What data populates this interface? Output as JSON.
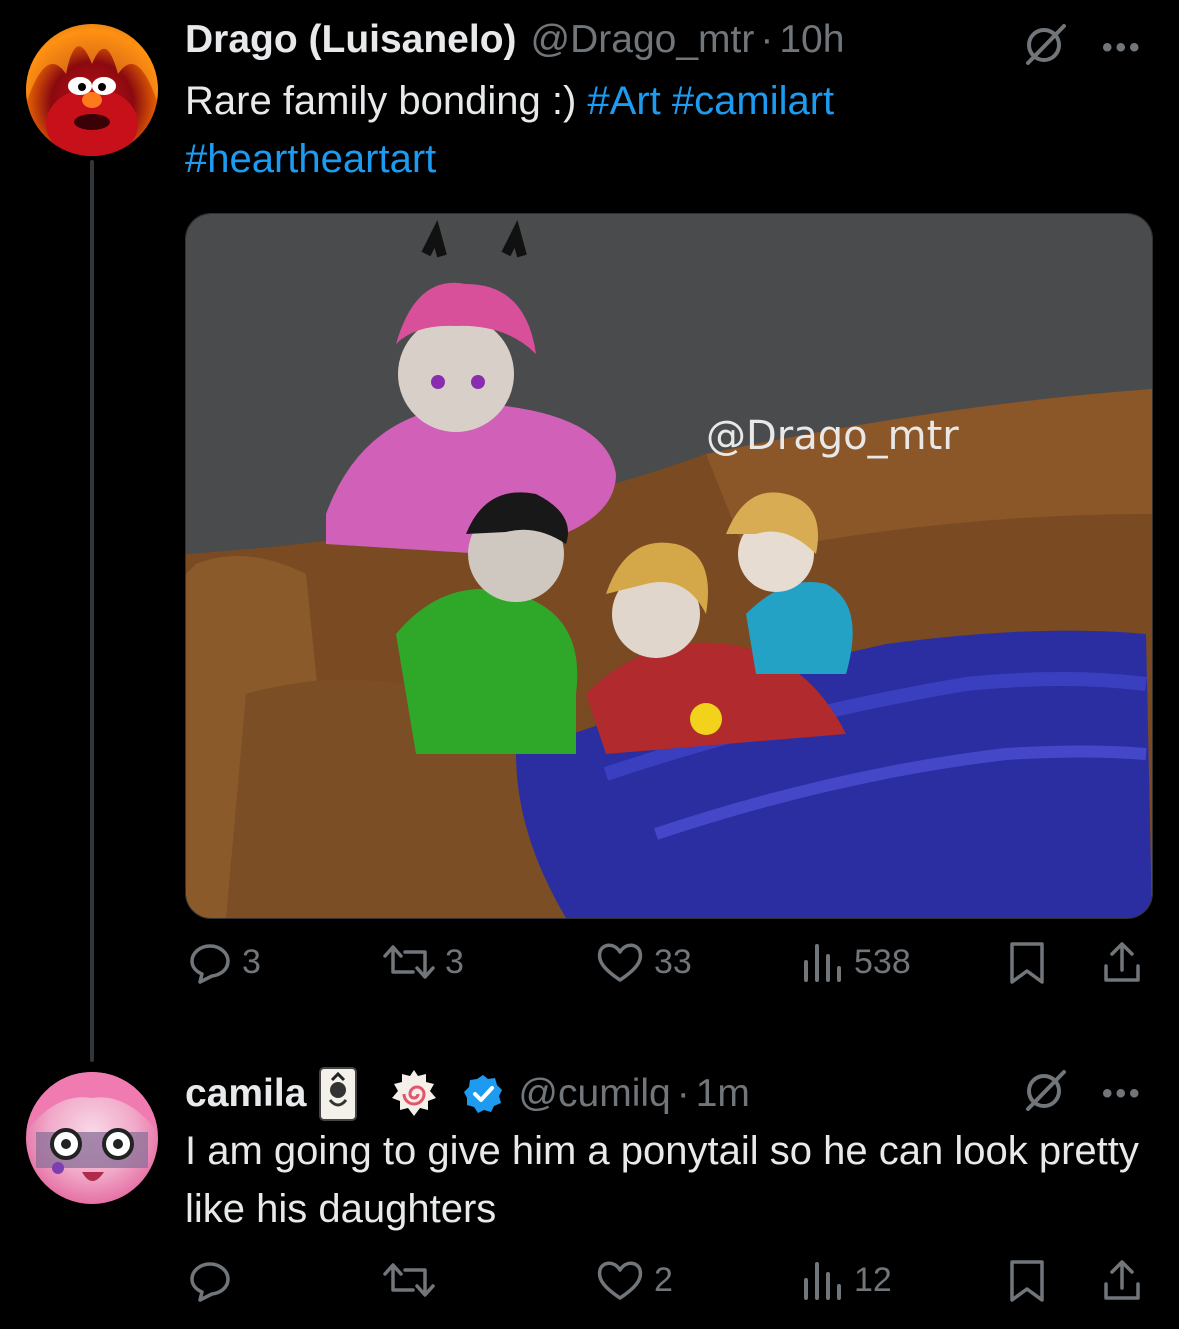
{
  "tweet1": {
    "name": "Drago (Luisanelo)",
    "handle": "@Drago_mtr",
    "dot": "·",
    "time": "10h",
    "text": "Rare family bonding :)",
    "hashtags": [
      "#Art",
      "#camilart",
      "#heartheartart"
    ],
    "media_watermark": "@Drago_mtr",
    "stats": {
      "replies": "3",
      "reposts": "3",
      "likes": "33",
      "views": "538"
    }
  },
  "tweet2": {
    "name": "camila",
    "handle": "@cumilq",
    "dot": "·",
    "time": "1m",
    "text": "I am going to give him a ponytail so he can look pretty like his daughters",
    "stats": {
      "replies": "",
      "reposts": "",
      "likes": "2",
      "views": "12"
    }
  },
  "colors": {
    "background": "#000000",
    "text": "#e7e9ea",
    "muted": "#71767b",
    "link": "#1d9bf0",
    "verified": "#1d9bf0"
  },
  "icons": [
    "reply-icon",
    "repost-icon",
    "like-icon",
    "views-icon",
    "bookmark-icon",
    "share-icon",
    "grok-icon",
    "more-icon",
    "verified-badge-icon",
    "card-emoji-icon",
    "naruto-emoji-icon"
  ]
}
